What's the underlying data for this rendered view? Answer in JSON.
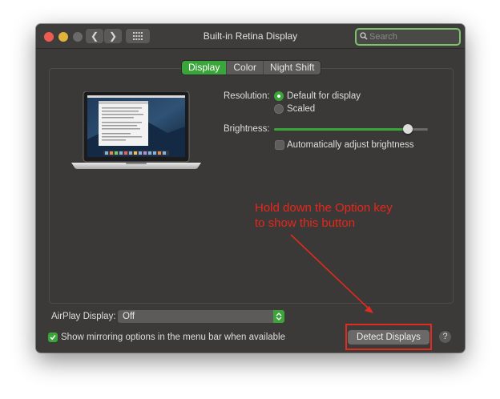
{
  "window": {
    "title": "Built-in Retina Display",
    "search_placeholder": "Search"
  },
  "tabs": [
    {
      "label": "Display",
      "active": true
    },
    {
      "label": "Color",
      "active": false
    },
    {
      "label": "Night Shift",
      "active": false
    }
  ],
  "resolution": {
    "label": "Resolution:",
    "options": [
      {
        "label": "Default for display",
        "selected": true
      },
      {
        "label": "Scaled",
        "selected": false
      }
    ]
  },
  "brightness": {
    "label": "Brightness:",
    "level": 0.87,
    "auto_adjust_label": "Automatically adjust brightness",
    "auto_adjust_checked": false
  },
  "airplay": {
    "label": "AirPlay Display:",
    "value": "Off"
  },
  "mirroring": {
    "label": "Show mirroring options in the menu bar when available",
    "checked": true
  },
  "detect_button": {
    "label": "Detect Displays"
  },
  "help_label": "?",
  "annotation": {
    "line1": "Hold down the Option key",
    "line2": "to show this button",
    "color": "#e8261a"
  },
  "colors": {
    "accent": "#3ba53a",
    "window_bg": "#3b3a38"
  },
  "icons": [
    "close-icon",
    "minimize-icon",
    "zoom-icon",
    "chevron-left-icon",
    "chevron-right-icon",
    "grid-icon",
    "search-icon",
    "help-icon",
    "updown-chevron-icon",
    "checkmark-icon"
  ]
}
